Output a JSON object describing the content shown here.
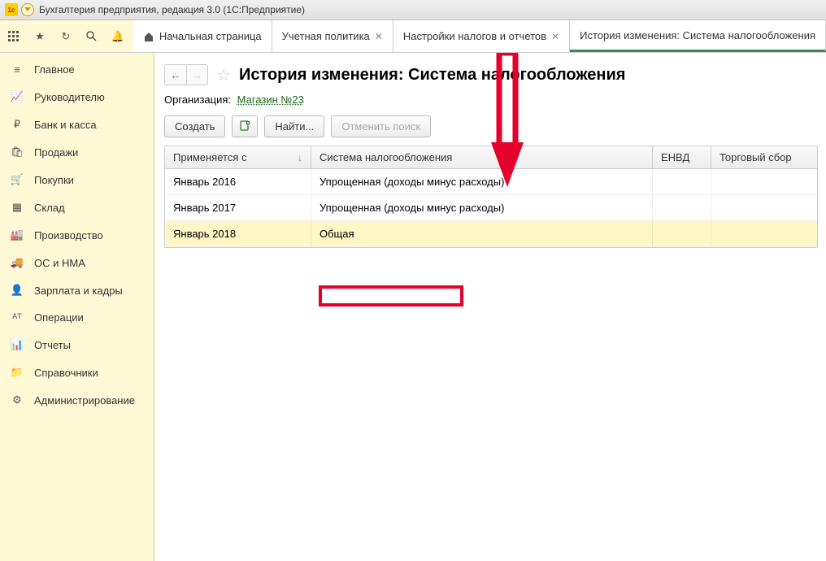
{
  "window": {
    "title": "Бухгалтерия предприятия, редакция 3.0  (1С:Предприятие)"
  },
  "tabs": [
    {
      "label": "Начальная страница",
      "home": true
    },
    {
      "label": "Учетная политика",
      "closable": true
    },
    {
      "label": "Настройки налогов и отчетов",
      "closable": true
    },
    {
      "label": "История изменения: Система налогообложения",
      "active": true
    }
  ],
  "sidebar": {
    "items": [
      {
        "label": "Главное",
        "icon": "≡"
      },
      {
        "label": "Руководителю",
        "icon": "📈"
      },
      {
        "label": "Банк и касса",
        "icon": "₽"
      },
      {
        "label": "Продажи",
        "icon": "🛍"
      },
      {
        "label": "Покупки",
        "icon": "🛒"
      },
      {
        "label": "Склад",
        "icon": "▦"
      },
      {
        "label": "Производство",
        "icon": "🏭"
      },
      {
        "label": "ОС и НМА",
        "icon": "🚚"
      },
      {
        "label": "Зарплата и кадры",
        "icon": "👤"
      },
      {
        "label": "Операции",
        "icon": "ᴬᵀ"
      },
      {
        "label": "Отчеты",
        "icon": "📊"
      },
      {
        "label": "Справочники",
        "icon": "📁"
      },
      {
        "label": "Администрирование",
        "icon": "⚙"
      }
    ]
  },
  "page": {
    "title": "История изменения: Система налогообложения",
    "org_label": "Организация:",
    "org_value": "Магазин №23",
    "toolbar": {
      "create": "Создать",
      "find": "Найти...",
      "cancel_search": "Отменить поиск"
    },
    "grid": {
      "headers": {
        "c1": "Применяется с",
        "c2": "Система налогообложения",
        "c3": "ЕНВД",
        "c4": "Торговый сбор"
      },
      "rows": [
        {
          "c1": "Январь 2016",
          "c2": "Упрощенная (доходы минус расходы)",
          "c3": "",
          "c4": ""
        },
        {
          "c1": "Январь 2017",
          "c2": "Упрощенная (доходы минус расходы)",
          "c3": "",
          "c4": ""
        },
        {
          "c1": "Январь 2018",
          "c2": "Общая",
          "c3": "",
          "c4": "",
          "selected": true
        }
      ]
    }
  },
  "annotation": {
    "arrow_color": "#e4002b"
  }
}
